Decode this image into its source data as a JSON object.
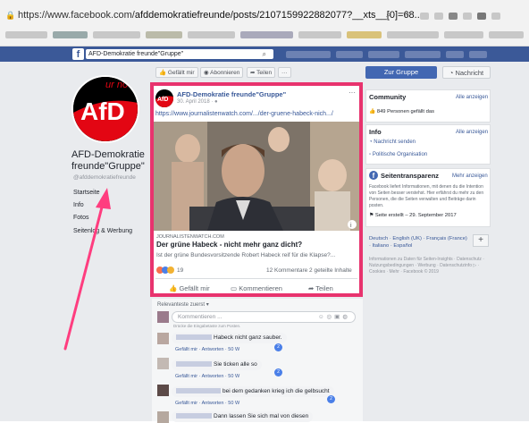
{
  "browser": {
    "url_prefix": "https://www.facebook.com/",
    "url_path": "afddemokratiefreunde/posts/2107159922882077?__xts__[0]=68..."
  },
  "fb": {
    "search_value": "AFD-Demokratie freunde\"Gruppe\""
  },
  "page": {
    "name_line1": "AFD-Demokratie",
    "name_line2": "freunde\"Gruppe\"",
    "handle": "@afddemokratiefreunde",
    "nav": [
      "Startseite",
      "Info",
      "Fotos",
      "Seitenlog & Werbung"
    ],
    "logo_text": "AfD",
    "logo_tag": "ur noch"
  },
  "toolbar": {
    "like": "Gefällt mir",
    "subscribe": "Abonnieren",
    "share": "Teilen",
    "more": "···"
  },
  "post": {
    "author": "AFD-Demokratie freunde\"Gruppe\"",
    "date": "30. April 2018 · ●",
    "link": "https://www.journalistenwatch.com/.../der-gruene-habeck-nich.../",
    "domain": "JOURNALISTENWATCH.COM",
    "headline": "Der grüne Habeck - nicht mehr ganz dicht?",
    "teaser": "Ist der grüne Bundesvorsitzende Robert Habeck reif für die Klapse?...",
    "reactions_count": "19",
    "comments_shares": "12 Kommentare  2 geteilte Inhalte",
    "actions": [
      "Gefällt mir",
      "Kommentieren",
      "Teilen"
    ]
  },
  "comments": {
    "sort_label": "Relevanteste zuerst ▾",
    "input_placeholder": "Kommentieren ...",
    "input_hint": "Drücke die Eingabetaste zum Posten.",
    "items": [
      {
        "text": "Habeck nicht ganz sauber.",
        "meta": "Gefällt mir · Antworten · 50 W",
        "badge": "2"
      },
      {
        "text": "Sie ticken alle so",
        "meta": "Gefällt mir · Antworten · 50 W",
        "badge": "2"
      },
      {
        "text": "bei dem gedanken krieg ich die gelbsucht",
        "meta": "Gefällt mir · Antworten · 50 W",
        "badge": "2"
      },
      {
        "text": "Dann lassen Sie sich mal von diesen",
        "meta": "",
        "badge": ""
      }
    ]
  },
  "right": {
    "group_button": "Zur Gruppe",
    "message_button": "Nachricht",
    "community_title": "Community",
    "show_all": "Alle anzeigen",
    "likes": "849 Personen gefällt das",
    "info_title": "Info",
    "send_message": "Nachricht senden",
    "category": "Politische Organisation",
    "transparency_title": "Seitentransparenz",
    "more_show": "Mehr anzeigen",
    "transparency_text": "Facebook liefert Informationen, mit denen du die Intention von Seiten besser verstehst. Hier erfährst du mehr zu den Personen, die die Seiten verwalten und Beiträge darin posten.",
    "created": "Seite erstellt – 29. September 2017",
    "languages": "Deutsch · English (UK) · Français (France) · Italiano · Español",
    "footer": "Informationen zu Daten für Seiten-Insights · Datenschutz · Nutzungsbedingungen · Werbung · Datenschutzinfo ▷ · Cookies · Mehr · Facebook © 2019",
    "plus": "+"
  },
  "colors": {
    "fb_blue": "#3b5998",
    "highlight": "#e8336e",
    "afd_red": "#e30613"
  }
}
